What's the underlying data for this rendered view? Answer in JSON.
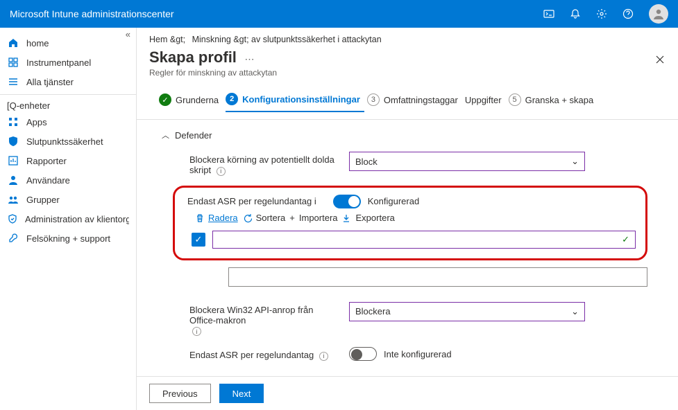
{
  "header": {
    "title": "Microsoft Intune administrationscenter"
  },
  "sidebar": {
    "items": [
      {
        "label": "home"
      },
      {
        "label": "Instrumentpanel"
      },
      {
        "label": "Alla tjänster"
      }
    ],
    "category": "[Q-enheter",
    "items2": [
      {
        "label": "Apps"
      },
      {
        "label": "Slutpunktssäkerhet"
      },
      {
        "label": "Rapporter"
      },
      {
        "label": "Användare"
      },
      {
        "label": "Grupper"
      },
      {
        "label": "Administration av klientorganisation"
      },
      {
        "label": "Felsökning + support"
      }
    ]
  },
  "breadcrumb": {
    "a": "Hem &gt;",
    "b": "Minskning &gt; av slutpunktssäkerhet i attackytan"
  },
  "pane": {
    "title": "Skapa profil",
    "subtitle": "Regler för minskning av attackytan"
  },
  "steps": {
    "s1": "Grunderna",
    "s2": "Konfigurationsinställningar",
    "s3": "Omfattningstaggar",
    "s4": "Uppgifter",
    "s5": "Granska + skapa",
    "n3": "3",
    "n5": "5"
  },
  "section": {
    "defender": "Defender",
    "row1": {
      "label": "Blockera körning av potentiellt dolda skript",
      "value": "Block"
    },
    "highlight": {
      "label": "Endast ASR per regelundantag",
      "toggle": "Konfigurerad",
      "delete": "Radera",
      "sort": "Sortera",
      "import": "Importera",
      "export": "Exportera",
      "plus": "+"
    },
    "row3": {
      "label": "Blockera Win32 API-anrop från Office-makron",
      "value": "Blockera"
    },
    "row4": {
      "label": "Endast ASR per regelundantag",
      "toggle": "Inte konfigurerad"
    }
  },
  "footer": {
    "prev": "Previous",
    "next": "Next"
  }
}
